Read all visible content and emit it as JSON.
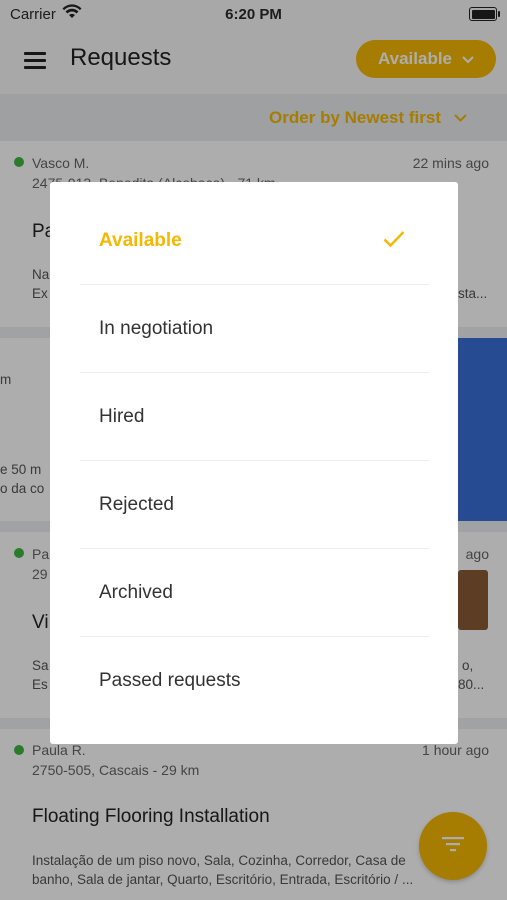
{
  "status_bar": {
    "carrier": "Carrier",
    "time": "6:20 PM"
  },
  "header": {
    "title": "Requests",
    "status_filter": "Available"
  },
  "order_bar": {
    "label": "Order by Newest first"
  },
  "background_cards": [
    {
      "name": "Vasco M.",
      "time": "22 mins ago",
      "location": "2475-013, Benedita (Alcobaça) - 71 km",
      "title_fragment": "Pa",
      "desc_fragments": [
        "Na",
        "Ex",
        "sta..."
      ]
    },
    {
      "left_fragments": [
        "m",
        "e 50 m",
        "o da co"
      ]
    },
    {
      "name_fragment": "Pa",
      "time_fragment": "ago",
      "location_fragment": "29",
      "title_fragment": "Vi",
      "desc_fragments": [
        "Sa",
        "Es",
        "o,",
        "80..."
      ]
    },
    {
      "name": "Paula R.",
      "time": "1 hour ago",
      "location": "2750-505, Cascais - 29 km",
      "title": "Floating Flooring Installation",
      "description_line1": "Instalação de um piso novo, Sala, Cozinha, Corredor, Casa de",
      "description_line2": "banho, Sala de jantar, Quarto, Escritório, Entrada, Escritório / ..."
    }
  ],
  "status_modal": {
    "options": [
      {
        "label": "Available",
        "selected": true
      },
      {
        "label": "In negotiation",
        "selected": false
      },
      {
        "label": "Hired",
        "selected": false
      },
      {
        "label": "Rejected",
        "selected": false
      },
      {
        "label": "Archived",
        "selected": false
      },
      {
        "label": "Passed requests",
        "selected": false
      }
    ]
  },
  "icons": {
    "menu": "menu-icon",
    "dropdown": "chevron-down-icon",
    "check": "check-icon",
    "filter": "filter-icon"
  },
  "colors": {
    "accent": "#f5b800",
    "online": "#3fb53f",
    "overlay": "rgba(0,0,0,0.32)"
  }
}
